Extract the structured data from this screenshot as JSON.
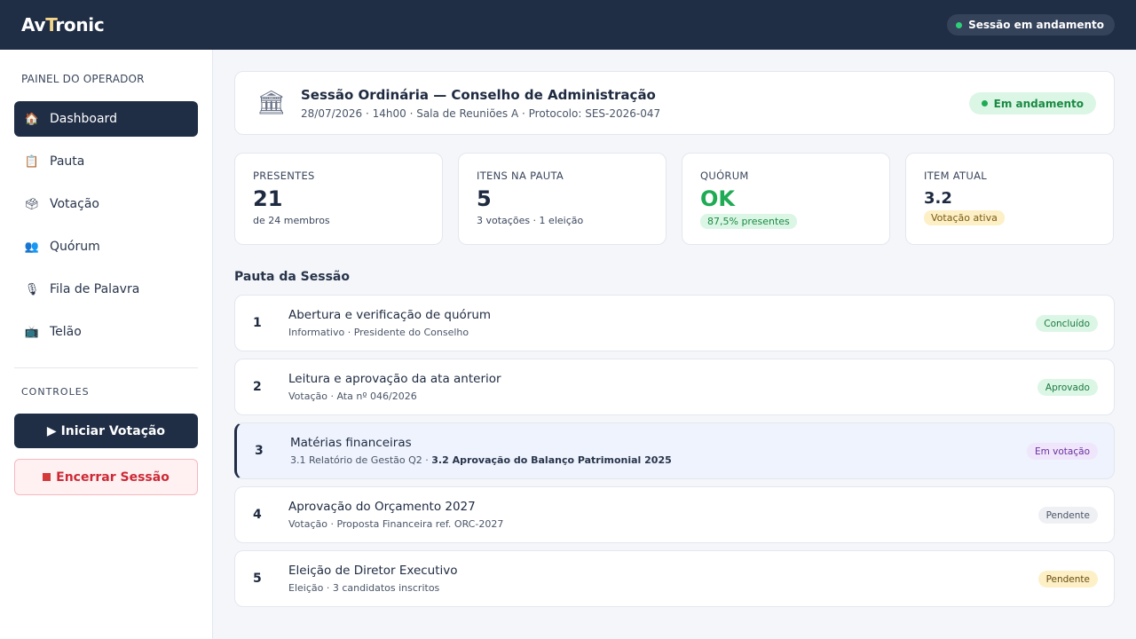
{
  "app": {
    "logo_pre": "Av",
    "logo_accent": "T",
    "logo_post": "ronic",
    "session_status": "Sessão em andamento"
  },
  "sidebar": {
    "title": "PAINEL DO OPERADOR",
    "items": [
      {
        "label": "Dashboard",
        "icon": "house-icon",
        "glyph": "🏠",
        "active": true
      },
      {
        "label": "Pauta",
        "icon": "clipboard-icon",
        "glyph": "📋"
      },
      {
        "label": "Votação",
        "icon": "ballot-box-icon",
        "glyph": "🗳"
      },
      {
        "label": "Quórum",
        "icon": "people-icon",
        "glyph": "👥"
      },
      {
        "label": "Fila de Palavra",
        "icon": "microphone-icon",
        "glyph": "🎙"
      },
      {
        "label": "Telão",
        "icon": "tv-icon",
        "glyph": "📺"
      }
    ],
    "controls_title": "CONTROLES",
    "start_vote_label": "▶ Iniciar Votação",
    "end_session_label": "Encerrar Sessão"
  },
  "session": {
    "title": "Sessão Ordinária — Conselho de Administração",
    "subtitle": "28/07/2026 · 14h00 · Sala de Reuniões A · Protocolo: SES-2026-047",
    "status": "Em andamento"
  },
  "stats": {
    "presentes": {
      "label": "PRESENTES",
      "value": "21",
      "sub": "de 24 membros"
    },
    "itens": {
      "label": "ITENS NA PAUTA",
      "value": "5",
      "sub": "3 votações · 1 eleição"
    },
    "quorum": {
      "label": "QUÓRUM",
      "value": "OK",
      "chip": "87,5% presentes"
    },
    "item_atual": {
      "label": "ITEM ATUAL",
      "value": "3.2",
      "chip": "Votação ativa"
    }
  },
  "agenda": {
    "title": "Pauta da Sessão",
    "items": [
      {
        "num": "1",
        "title": "Abertura e verificação de quórum",
        "sub": "Informativo · Presidente do Conselho",
        "badge": "Concluído"
      },
      {
        "num": "2",
        "title": "Leitura e aprovação da ata anterior",
        "sub": "Votação · Ata nº 046/2026",
        "badge": "Aprovado"
      },
      {
        "num": "3",
        "title": "Matérias financeiras",
        "sub_prefix": "3.1 Relatório de Gestão Q2 · ",
        "sub_bold": "3.2 Aprovação do Balanço Patrimonial 2025",
        "badge": "Em votação"
      },
      {
        "num": "4",
        "title": "Aprovação do Orçamento 2027",
        "sub": "Votação · Proposta Financeira ref. ORC-2027",
        "badge": "Pendente"
      },
      {
        "num": "5",
        "title": "Eleição de Diretor Executivo",
        "sub": "Eleição · 3 candidatos inscritos",
        "badge": "Pendente"
      }
    ]
  },
  "colors": {
    "navy": "#1f2d45",
    "green": "#1faa54",
    "red": "#cc2a36"
  }
}
